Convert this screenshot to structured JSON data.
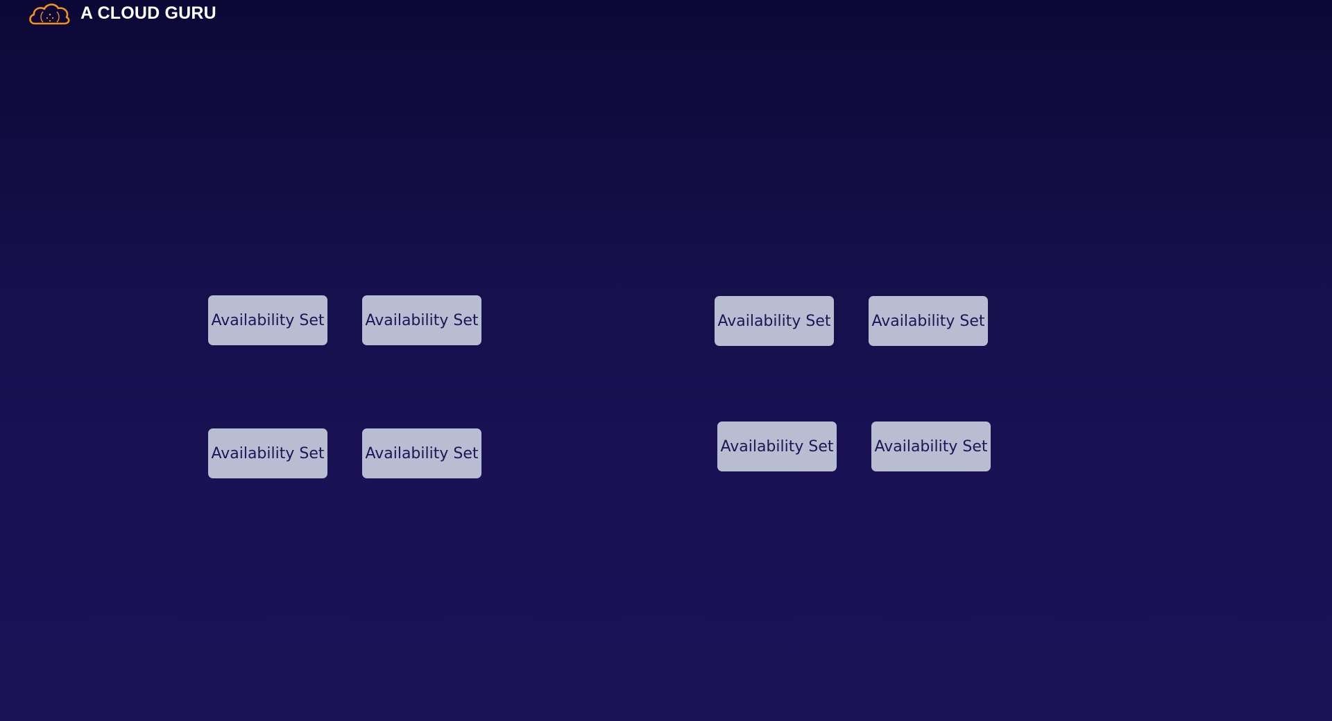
{
  "brand": {
    "name": "A CLOUD GURU",
    "logo_icon": "cloud-logo-icon",
    "logo_color": "#f5921b"
  },
  "diagram": {
    "left_group": [
      {
        "label": "Availability Set"
      },
      {
        "label": "Availability Set"
      },
      {
        "label": "Availability Set"
      },
      {
        "label": "Availability Set"
      }
    ],
    "right_group": [
      {
        "label": "Availability Set"
      },
      {
        "label": "Availability Set"
      },
      {
        "label": "Availability Set"
      },
      {
        "label": "Availability Set"
      }
    ]
  },
  "colors": {
    "background_top": "#0c0836",
    "background_bottom": "#1b1356",
    "box_fill": "#b8bdd2",
    "box_text": "#1c1656"
  }
}
